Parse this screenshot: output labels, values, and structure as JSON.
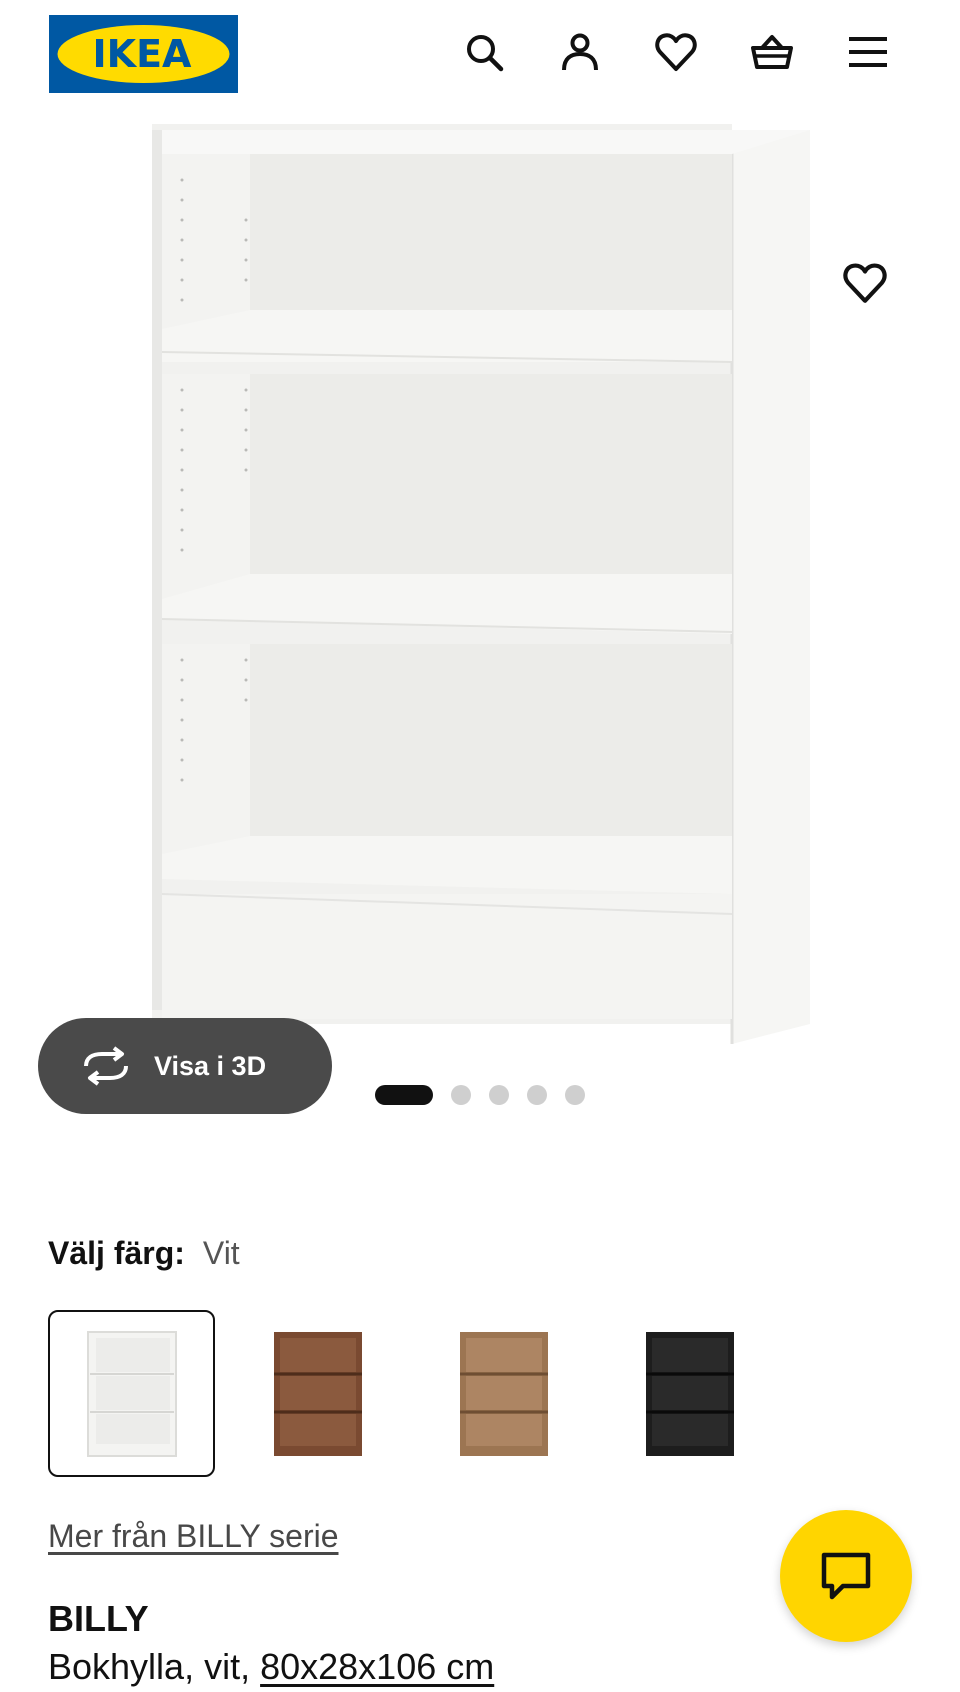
{
  "header": {
    "logo_text": "IKEA",
    "logo_icon": "ikea-logo",
    "icons": [
      "search-icon",
      "user-icon",
      "heart-icon",
      "basket-icon",
      "menu-icon"
    ]
  },
  "gallery": {
    "favorite_icon": "heart-icon",
    "view_3d_label": "Visa i 3D",
    "view_3d_icon": "rotate-icon",
    "page_count": 5,
    "active_page": 1
  },
  "color": {
    "label": "Välj färg:",
    "value": "Vit",
    "options": [
      {
        "name": "white",
        "color": "#f3f3f1",
        "selected": true
      },
      {
        "name": "brown walnut",
        "color": "#7a4a31",
        "selected": false
      },
      {
        "name": "oak effect",
        "color": "#9c7552",
        "selected": false
      },
      {
        "name": "black-brown",
        "color": "#1d1d1d",
        "selected": false
      }
    ]
  },
  "series_link": "Mer från BILLY serie",
  "product": {
    "name": "BILLY",
    "description": "Bokhylla, vit, ",
    "dimensions": "80x28x106 cm"
  },
  "chat": {
    "icon": "chat-icon"
  },
  "colors": {
    "logo_blue": "#0058a3",
    "logo_yellow": "#ffdb00",
    "chat_yellow": "#ffd500",
    "overlay_gray": "#4a4a4a"
  }
}
